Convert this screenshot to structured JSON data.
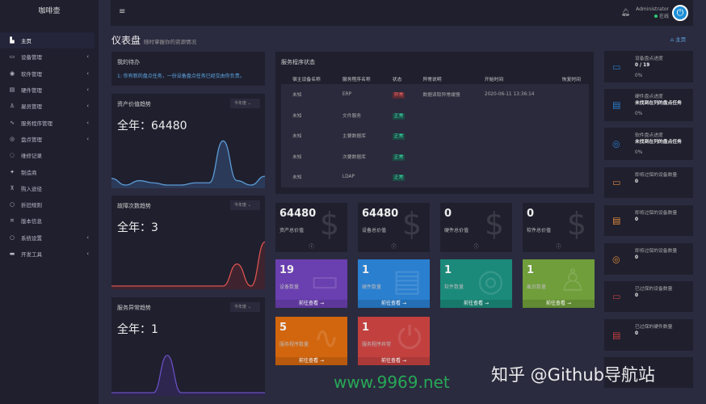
{
  "app": {
    "title": "咖啡壶"
  },
  "sidebar": {
    "items": [
      {
        "label": "主页",
        "icon": "dashboard-icon",
        "glyph": "▙",
        "chevron": false
      },
      {
        "label": "设备管理",
        "icon": "monitor-icon",
        "glyph": "▭",
        "chevron": true
      },
      {
        "label": "软件管理",
        "icon": "disc-icon",
        "glyph": "◉",
        "chevron": true
      },
      {
        "label": "硬件管理",
        "icon": "server-icon",
        "glyph": "▤",
        "chevron": true
      },
      {
        "label": "雇员管理",
        "icon": "user-check-icon",
        "glyph": "♙",
        "chevron": true
      },
      {
        "label": "服务程序管理",
        "icon": "activity-icon",
        "glyph": "∿",
        "chevron": true
      },
      {
        "label": "盘点管理",
        "icon": "check-circle-icon",
        "glyph": "◎",
        "chevron": true
      },
      {
        "label": "维修记录",
        "icon": "shield-icon",
        "glyph": "◌",
        "chevron": false
      },
      {
        "label": "制造商",
        "icon": "factory-icon",
        "glyph": "✦",
        "chevron": false
      },
      {
        "label": "购入途径",
        "icon": "cart-icon",
        "glyph": "⊼",
        "chevron": false
      },
      {
        "label": "折旧规则",
        "icon": "circle-icon",
        "glyph": "○",
        "chevron": false
      },
      {
        "label": "版本信息",
        "icon": "info-icon",
        "glyph": "¤",
        "chevron": false
      },
      {
        "label": "系统设置",
        "icon": "settings-icon",
        "glyph": "○",
        "chevron": true
      },
      {
        "label": "开发工具",
        "icon": "keyboard-icon",
        "glyph": "▬",
        "chevron": true
      }
    ]
  },
  "header": {
    "user": "Administrator",
    "status": "在线"
  },
  "page": {
    "title": "仪表盘",
    "subtitle": "随时掌握你的资源情况",
    "breadcrumb": "主页"
  },
  "todo": {
    "title": "我的待办",
    "items": [
      "1: 你有新的盘点任务，一份设备盘点任务已经交由你负责。"
    ]
  },
  "trends": [
    {
      "title": "资产价值趋势",
      "select": "今年度",
      "total": "全年：64480",
      "color": "#5b9bd5",
      "fill": "rgba(70,110,170,0.35)",
      "values": [
        3,
        0,
        2,
        1,
        0,
        0,
        1,
        1,
        20,
        2,
        0,
        4
      ],
      "max": 22
    },
    {
      "title": "故障次数趋势",
      "select": "今年度",
      "total": "全年：3",
      "color": "#d9534f",
      "fill": "rgba(160,50,50,0.25)",
      "values": [
        0,
        0,
        0,
        0,
        0,
        0,
        0,
        0,
        0,
        1,
        0,
        2
      ],
      "max": 2.2
    },
    {
      "title": "服务异常趋势",
      "select": "今年度",
      "total": "全年：1",
      "color": "#6a4fc0",
      "fill": "rgba(90,60,180,0.25)",
      "values": [
        0,
        0,
        0,
        0,
        1,
        0,
        0,
        0,
        0,
        0,
        0,
        0
      ],
      "max": 1.3
    }
  ],
  "services": {
    "title": "服务程序状态",
    "columns": [
      "宿主设备名称",
      "服务程序名称",
      "状态",
      "异常说明",
      "开始时间",
      "恢复时间"
    ],
    "rows": [
      {
        "host": "未知",
        "name": "ERP",
        "status": "异常",
        "ok": false,
        "desc": "数据读取异常缓慢",
        "start": "2020-06-11 13:36:14",
        "end": ""
      },
      {
        "host": "未知",
        "name": "文件服务",
        "status": "正常",
        "ok": true,
        "desc": "",
        "start": "",
        "end": ""
      },
      {
        "host": "未知",
        "name": "主要数据库",
        "status": "正常",
        "ok": true,
        "desc": "",
        "start": "",
        "end": ""
      },
      {
        "host": "未知",
        "name": "次要数据库",
        "status": "正常",
        "ok": true,
        "desc": "",
        "start": "",
        "end": ""
      },
      {
        "host": "未知",
        "name": "LDAP",
        "status": "正常",
        "ok": true,
        "desc": "",
        "start": "",
        "end": ""
      }
    ]
  },
  "value_cards": [
    {
      "value": "64480",
      "label": "资产总价值"
    },
    {
      "value": "64480",
      "label": "设备总价值"
    },
    {
      "value": "0",
      "label": "硬件总价值"
    },
    {
      "value": "0",
      "label": "软件总价值"
    }
  ],
  "count_cards": [
    {
      "value": "19",
      "label": "设备数量",
      "link": "前往查看 →",
      "color": "#6a3fb0",
      "icon": "monitor-icon",
      "glyph": "▭"
    },
    {
      "value": "1",
      "label": "硬件数量",
      "link": "前往查看 →",
      "color": "#2a7fcf",
      "icon": "server-icon",
      "glyph": "▤"
    },
    {
      "value": "1",
      "label": "软件数量",
      "link": "前往查看 →",
      "color": "#1b8a7a",
      "icon": "disc-icon",
      "glyph": "◎"
    },
    {
      "value": "1",
      "label": "雇员数量",
      "link": "前往查看 →",
      "color": "#6f9e3a",
      "icon": "user-check-icon",
      "glyph": "♙"
    },
    {
      "value": "5",
      "label": "服务程序数量",
      "link": "前往查看 →",
      "color": "#d2660f",
      "icon": "activity-icon",
      "glyph": "∿"
    },
    {
      "value": "1",
      "label": "服务程序异常",
      "link": "前往查看 →",
      "color": "#c2413f",
      "icon": "power-icon",
      "glyph": "⏻"
    }
  ],
  "right_cards": [
    {
      "title": "设备盘点进度",
      "value": "0 / 19",
      "progress": "0%",
      "icon": "monitor-icon",
      "glyph": "▭",
      "color": "#2a7fcf"
    },
    {
      "title": "硬件盘点进度",
      "value": "未找到在列的盘点任务",
      "progress": "0%",
      "icon": "server-icon",
      "glyph": "▤",
      "color": "#2a7fcf"
    },
    {
      "title": "软件盘点进度",
      "value": "未找到在列的盘点任务",
      "progress": "0%",
      "icon": "disc-icon",
      "glyph": "◎",
      "color": "#2a7fcf"
    },
    {
      "title": "即将过保的设备数量",
      "value": "0",
      "icon": "monitor-icon",
      "glyph": "▭",
      "color": "#e08a3a"
    },
    {
      "title": "即将过保的设备数量",
      "value": "0",
      "icon": "server-icon",
      "glyph": "▤",
      "color": "#e08a3a"
    },
    {
      "title": "即将过保的设备数量",
      "value": "0",
      "icon": "disc-icon",
      "glyph": "◎",
      "color": "#e08a3a"
    },
    {
      "title": "已过保的设备数量",
      "value": "0",
      "icon": "monitor-icon",
      "glyph": "▭",
      "color": "#c2413f"
    },
    {
      "title": "已过保的硬件数量",
      "value": "0",
      "icon": "server-icon",
      "glyph": "▤",
      "color": "#c2413f"
    },
    {
      "title": "",
      "value": "",
      "icon": "disc-icon",
      "glyph": "",
      "color": "#c2413f"
    }
  ],
  "watermarks": {
    "zhihu": "知乎 @Github导航站",
    "site": "www.9969.net"
  }
}
